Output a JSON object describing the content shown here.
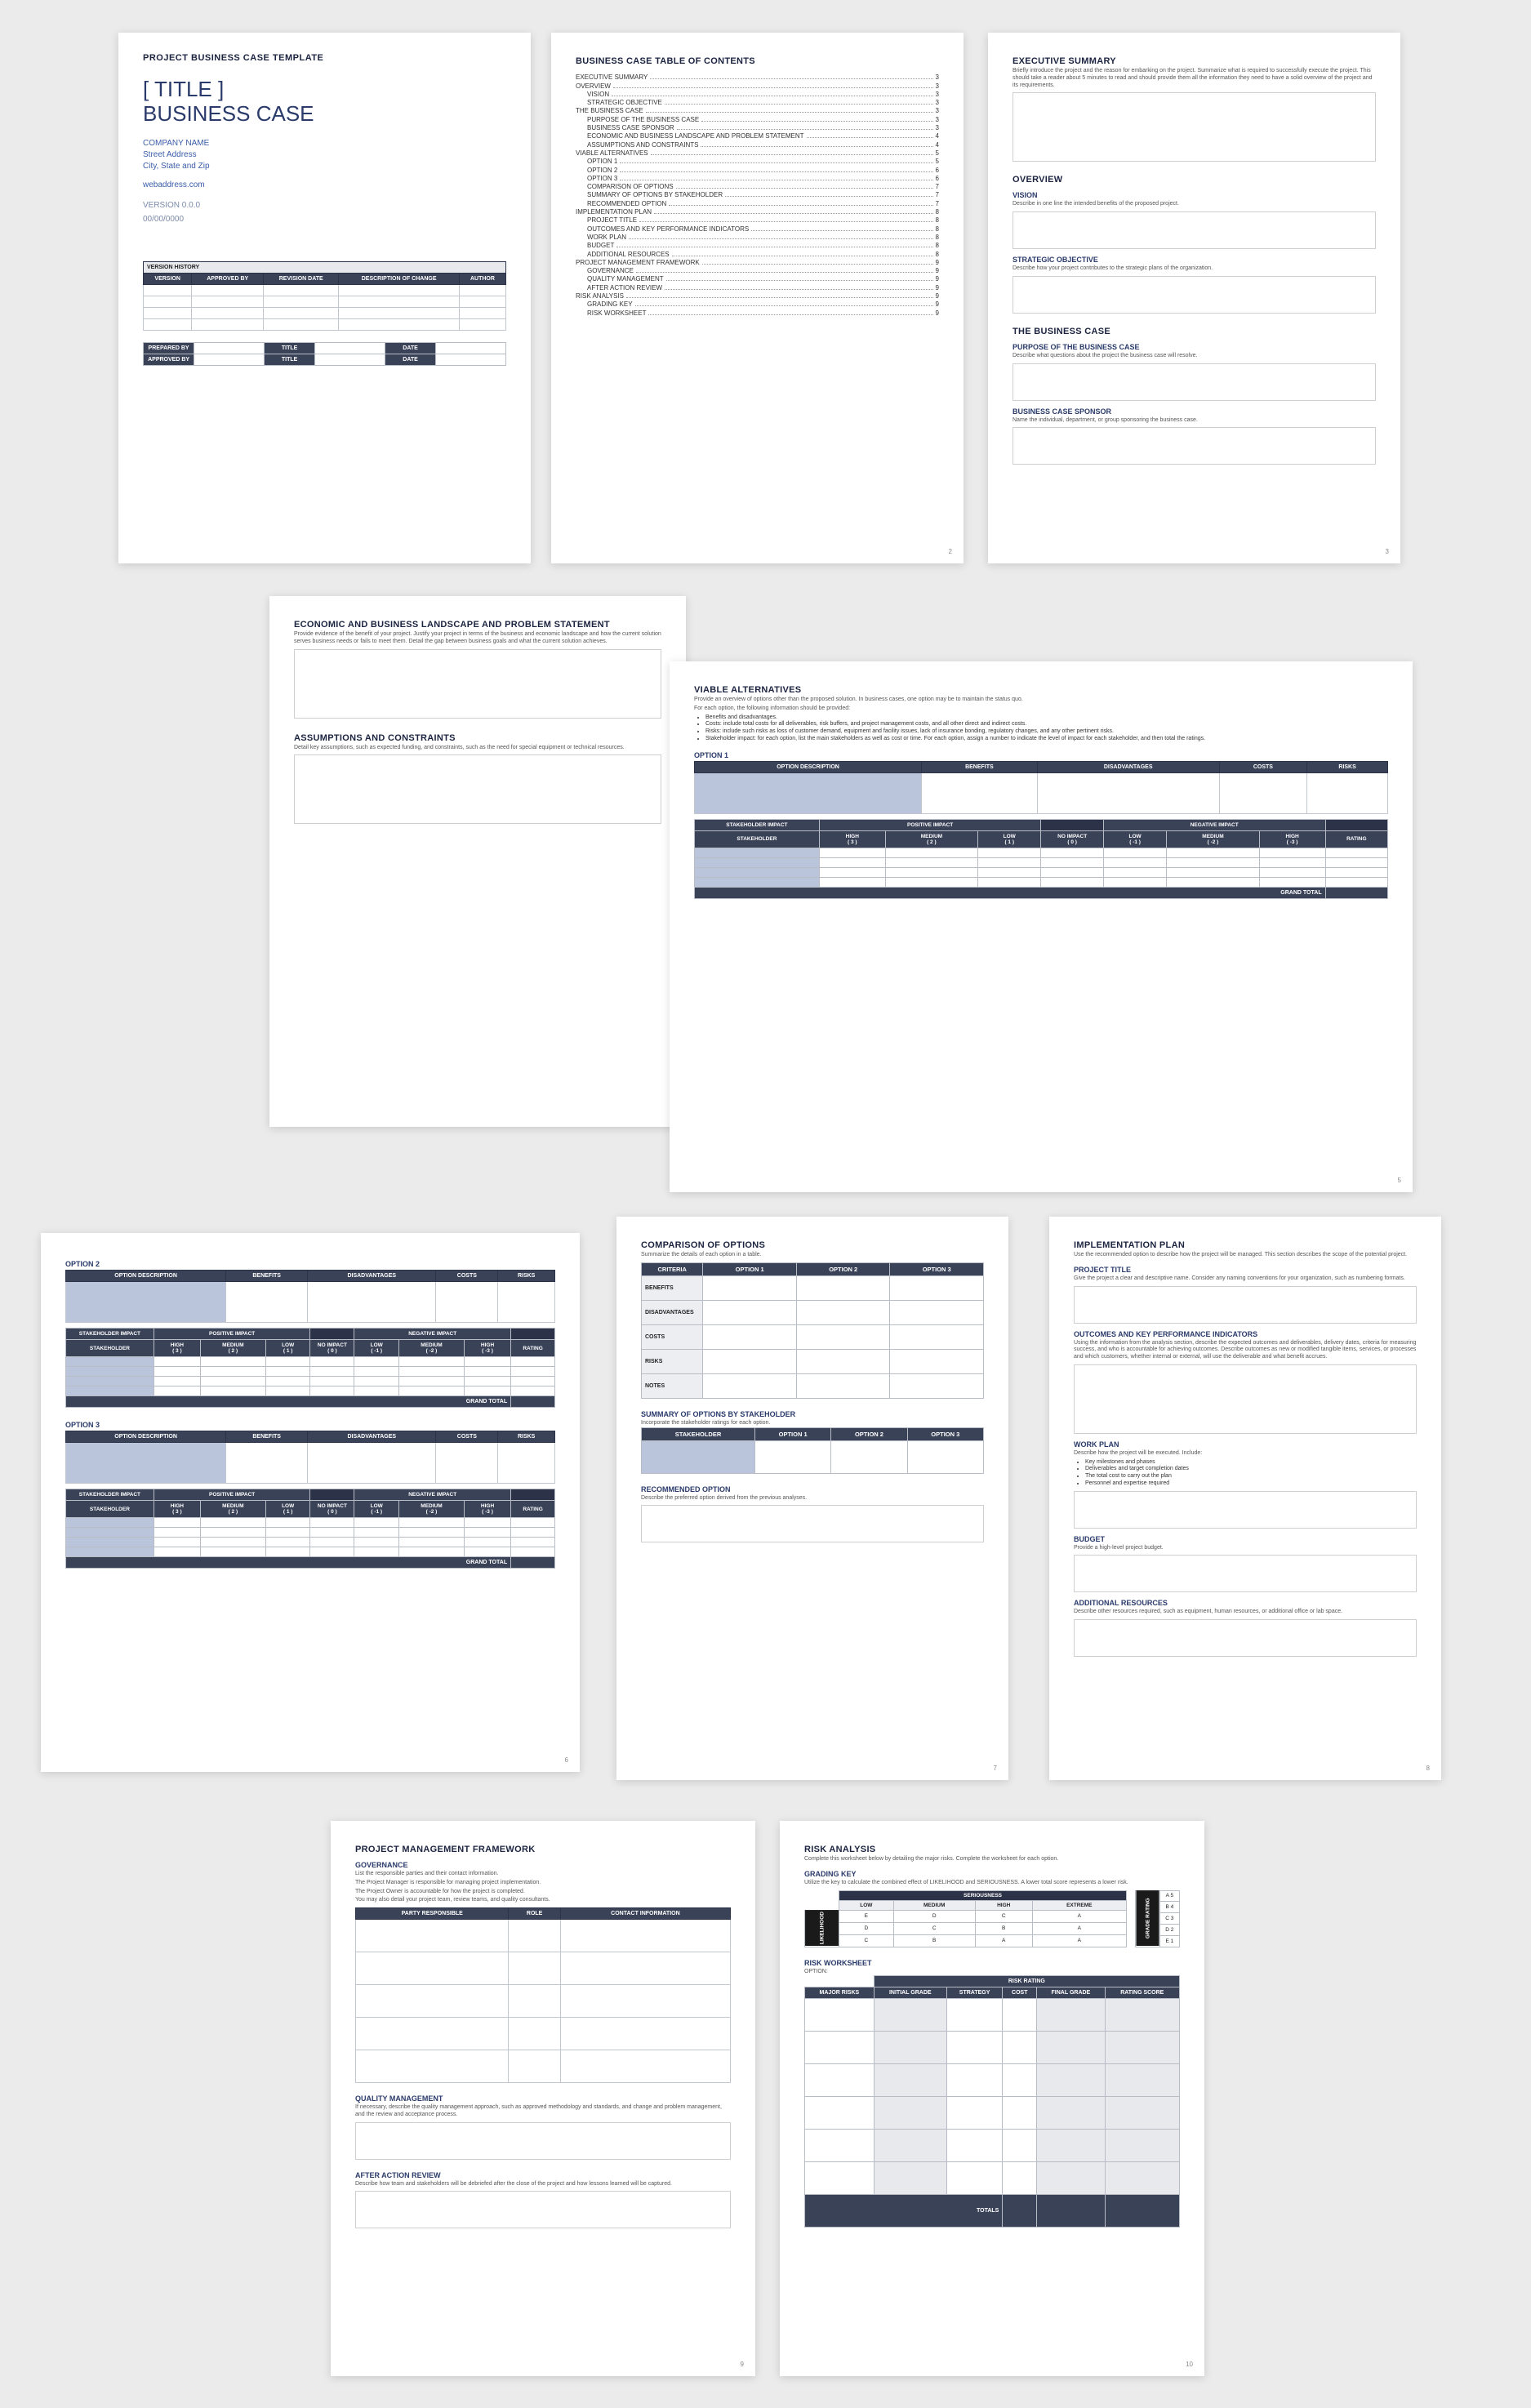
{
  "doc_header": "PROJECT BUSINESS CASE TEMPLATE",
  "title_line1": "[ TITLE ]",
  "title_line2": "BUSINESS CASE",
  "company": {
    "name": "COMPANY NAME",
    "street": "Street Address",
    "city": "City, State and Zip"
  },
  "web": "webaddress.com",
  "version": "VERSION 0.0.0",
  "date": "00/00/0000",
  "vh": {
    "title": "VERSION HISTORY",
    "cols": [
      "VERSION",
      "APPROVED BY",
      "REVISION DATE",
      "DESCRIPTION OF CHANGE",
      "AUTHOR"
    ]
  },
  "sign": {
    "r1": {
      "a": "PREPARED BY",
      "b": "TITLE",
      "c": "DATE"
    },
    "r2": {
      "a": "APPROVED BY",
      "b": "TITLE",
      "c": "DATE"
    }
  },
  "toc": {
    "title": "BUSINESS CASE TABLE OF CONTENTS",
    "items": [
      {
        "t": "EXECUTIVE SUMMARY",
        "p": "3",
        "s": 0
      },
      {
        "t": "OVERVIEW",
        "p": "3",
        "s": 0
      },
      {
        "t": "VISION",
        "p": "3",
        "s": 1
      },
      {
        "t": "STRATEGIC OBJECTIVE",
        "p": "3",
        "s": 1
      },
      {
        "t": "THE BUSINESS CASE",
        "p": "3",
        "s": 0
      },
      {
        "t": "PURPOSE OF THE BUSINESS CASE",
        "p": "3",
        "s": 1
      },
      {
        "t": "BUSINESS CASE SPONSOR",
        "p": "3",
        "s": 1
      },
      {
        "t": "ECONOMIC AND BUSINESS LANDSCAPE AND PROBLEM STATEMENT",
        "p": "4",
        "s": 1
      },
      {
        "t": "ASSUMPTIONS AND CONSTRAINTS",
        "p": "4",
        "s": 1
      },
      {
        "t": "VIABLE ALTERNATIVES",
        "p": "5",
        "s": 0
      },
      {
        "t": "OPTION 1",
        "p": "5",
        "s": 1
      },
      {
        "t": "OPTION 2",
        "p": "6",
        "s": 1
      },
      {
        "t": "OPTION 3",
        "p": "6",
        "s": 1
      },
      {
        "t": "COMPARISON OF OPTIONS",
        "p": "7",
        "s": 1
      },
      {
        "t": "SUMMARY OF OPTIONS BY STAKEHOLDER",
        "p": "7",
        "s": 1
      },
      {
        "t": "RECOMMENDED OPTION",
        "p": "7",
        "s": 1
      },
      {
        "t": "IMPLEMENTATION PLAN",
        "p": "8",
        "s": 0
      },
      {
        "t": "PROJECT TITLE",
        "p": "8",
        "s": 1
      },
      {
        "t": "OUTCOMES AND KEY PERFORMANCE INDICATORS",
        "p": "8",
        "s": 1
      },
      {
        "t": "WORK PLAN",
        "p": "8",
        "s": 1
      },
      {
        "t": "BUDGET",
        "p": "8",
        "s": 1
      },
      {
        "t": "ADDITIONAL RESOURCES",
        "p": "8",
        "s": 1
      },
      {
        "t": "PROJECT MANAGEMENT FRAMEWORK",
        "p": "9",
        "s": 0
      },
      {
        "t": "GOVERNANCE",
        "p": "9",
        "s": 1
      },
      {
        "t": "QUALITY MANAGEMENT",
        "p": "9",
        "s": 1
      },
      {
        "t": "AFTER ACTION REVIEW",
        "p": "9",
        "s": 1
      },
      {
        "t": "RISK ANALYSIS",
        "p": "9",
        "s": 0
      },
      {
        "t": "GRADING KEY",
        "p": "9",
        "s": 1
      },
      {
        "t": "RISK WORKSHEET",
        "p": "9",
        "s": 1
      }
    ]
  },
  "p3": {
    "exec_h": "EXECUTIVE SUMMARY",
    "exec_d": "Briefly introduce the project and the reason for embarking on the project. Summarize what is required to successfully execute the project. This should take a reader about 5 minutes to read and should provide them all the information they need to have a solid overview of the project and its requirements.",
    "over_h": "OVERVIEW",
    "vision_h": "VISION",
    "vision_d": "Describe in one line the intended benefits of the proposed project.",
    "strat_h": "STRATEGIC OBJECTIVE",
    "strat_d": "Describe how your project contributes to the strategic plans of the organization.",
    "bc_h": "THE BUSINESS CASE",
    "purp_h": "PURPOSE OF THE BUSINESS CASE",
    "purp_d": "Describe what questions about the project the business case will resolve.",
    "spons_h": "BUSINESS CASE SPONSOR",
    "spons_d": "Name the individual, department, or group sponsoring the business case."
  },
  "p4": {
    "h1": "ECONOMIC AND BUSINESS LANDSCAPE AND PROBLEM STATEMENT",
    "d1": "Provide evidence of the benefit of your project. Justify your project in terms of the business and economic landscape and how the current solution serves business needs or fails to meet them. Detail the gap between business goals and what the current solution achieves.",
    "h2": "ASSUMPTIONS AND CONSTRAINTS",
    "d2": "Detail key assumptions, such as expected funding, and constraints, such as the need for special equipment or technical resources."
  },
  "p5": {
    "h": "VIABLE ALTERNATIVES",
    "d1": "Provide an overview of options other than the proposed solution. In business cases, one option may be to maintain the status quo.",
    "d2": "For each option, the following information should be provided:",
    "b1": "Benefits and disadvantages.",
    "b2": "Costs: include total costs for all deliverables, risk buffers, and project management costs, and all other direct and indirect costs.",
    "b3": "Risks: include such risks as loss of customer demand, equipment and facility issues, lack of insurance bonding, regulatory changes, and any other pertinent risks.",
    "b4": "Stakeholder impact: for each option, list the main stakeholders as well as cost or time. For each option, assign a number to indicate the level of impact for each stakeholder, and then total the ratings.",
    "opt_h": "OPTION 1",
    "row_cols": [
      "OPTION DESCRIPTION",
      "BENEFITS",
      "DISADVANTAGES",
      "COSTS",
      "RISKS"
    ],
    "si_h": "STAKEHOLDER IMPACT",
    "pi_h": "POSITIVE IMPACT",
    "ni_h": "NEGATIVE IMPACT",
    "stk": "STAKEHOLDER",
    "cols": [
      "HIGH\n( 3 )",
      "MEDIUM\n( 2 )",
      "LOW\n( 1 )",
      "NO IMPACT\n( 0 )",
      "LOW\n( -1 )",
      "MEDIUM\n( -2 )",
      "HIGH\n( -3 )",
      "RATING"
    ],
    "grand": "GRAND TOTAL"
  },
  "p6": {
    "o2": "OPTION 2",
    "o3": "OPTION 3"
  },
  "p7": {
    "h": "COMPARISON OF OPTIONS",
    "d": "Summarize the details of each option in a table.",
    "cols": [
      "CRITERIA",
      "OPTION 1",
      "OPTION 2",
      "OPTION 3"
    ],
    "rows": [
      "BENEFITS",
      "DISADVANTAGES",
      "COSTS",
      "RISKS",
      "NOTES"
    ],
    "sum_h": "SUMMARY OF OPTIONS BY STAKEHOLDER",
    "sum_d": "Incorporate the stakeholder ratings for each option.",
    "sum_cols": [
      "STAKEHOLDER",
      "OPTION 1",
      "OPTION 2",
      "OPTION 3"
    ],
    "rec_h": "RECOMMENDED OPTION",
    "rec_d": "Describe the preferred option derived from the previous analyses."
  },
  "p8": {
    "h": "IMPLEMENTATION PLAN",
    "d": "Use the recommended option to describe how the project will be managed. This section describes the scope of the potential project.",
    "pt_h": "PROJECT TITLE",
    "pt_d": "Give the project a clear and descriptive name. Consider any naming conventions for your organization, such as numbering formats.",
    "kpi_h": "OUTCOMES AND KEY PERFORMANCE INDICATORS",
    "kpi_d": "Using the information from the analysis section, describe the expected outcomes and deliverables, delivery dates, criteria for measuring success, and who is accountable for achieving outcomes. Describe outcomes as new or modified tangible items, services, or processes and which customers, whether internal or external, will use the deliverable and what benefit accrues.",
    "wp_h": "WORK PLAN",
    "wp_d": "Describe how the project will be executed. Include:",
    "wp_b1": "Key milestones and phases",
    "wp_b2": "Deliverables and target completion dates",
    "wp_b3": "The total cost to carry out the plan",
    "wp_b4": "Personnel and expertise required",
    "bud_h": "BUDGET",
    "bud_d": "Provide a high-level project budget.",
    "res_h": "ADDITIONAL RESOURCES",
    "res_d": "Describe other resources required, such as equipment, human resources, or additional office or lab space."
  },
  "p9": {
    "h": "PROJECT MANAGEMENT FRAMEWORK",
    "gov_h": "GOVERNANCE",
    "gov_d1": "List the responsible parties and their contact information.",
    "gov_d2": "The Project Manager is responsible for managing project implementation.",
    "gov_d3": "The Project Owner is accountable for how the project is completed.",
    "gov_d4": "You may also detail your project team, review teams, and quality consultants.",
    "gov_cols": [
      "PARTY RESPONSIBLE",
      "ROLE",
      "CONTACT INFORMATION"
    ],
    "qm_h": "QUALITY MANAGEMENT",
    "qm_d": "If necessary, describe the quality management approach, such as approved methodology and standards, and change and problem management, and the review and acceptance process.",
    "aar_h": "AFTER ACTION REVIEW",
    "aar_d": "Describe how team and stakeholders will be debriefed after the close of the project and how lessons learned will be captured."
  },
  "p10": {
    "h": "RISK ANALYSIS",
    "d": "Complete this worksheet below by detailing the major risks. Complete the worksheet for each option.",
    "gk_h": "GRADING KEY",
    "gk_d": "Utilize the key to calculate the combined effect of LIKELIHOOD and SERIOUSNESS. A lower total score represents a lower risk.",
    "gk_ser": "SERIOUSNESS",
    "gk_lik": "LIKELIHOOD",
    "gk_gr": "GRADE  RATING",
    "gk_cols": [
      "LOW",
      "MEDIUM",
      "HIGH",
      "EXTREME"
    ],
    "gk_rows": [
      "LOW",
      "MEDIUM",
      "HIGH"
    ],
    "gk_cells": [
      [
        "E",
        "D",
        "C",
        "A"
      ],
      [
        "D",
        "C",
        "B",
        "A"
      ],
      [
        "C",
        "B",
        "A",
        "A"
      ]
    ],
    "gk_r": [
      "A  5",
      "B  4",
      "C  3",
      "D  2",
      "E  1"
    ],
    "ws_h": "RISK WORKSHEET",
    "ws_opt": "OPTION:",
    "ws_rr": "RISK RATING",
    "ws_cols": [
      "MAJOR RISKS",
      "INITIAL GRADE",
      "STRATEGY",
      "COST",
      "FINAL GRADE",
      "RATING SCORE"
    ],
    "totals": "TOTALS"
  }
}
